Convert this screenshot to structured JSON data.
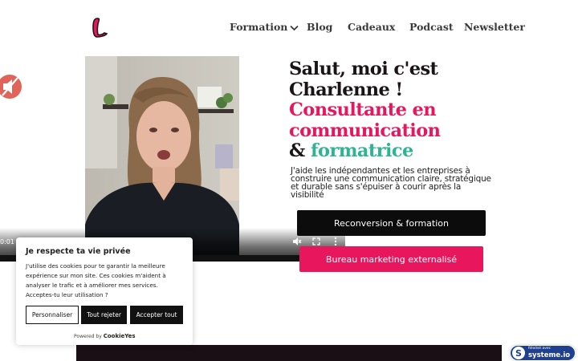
{
  "nav": {
    "items": [
      {
        "label": "Formation"
      },
      {
        "label": "Blog"
      },
      {
        "label": "Cadeaux"
      },
      {
        "label": "Podcast"
      },
      {
        "label": "Newsletter"
      }
    ]
  },
  "video": {
    "time": "0:01 /"
  },
  "hero": {
    "line1": "Salut, moi c'est",
    "line2": "Charlenne !",
    "line3": "Consultante en",
    "line4": "communication",
    "amp": "&",
    "line5": "formatrice",
    "description": "J'aide les indépendantes et les entreprises à construire une communication claire, stratégique et durable sans s'épuiser à courir après la visibilité"
  },
  "buttons": {
    "reconversion": "Reconversion & formation",
    "bureau": "Bureau marketing externalisé"
  },
  "cookie": {
    "title": "Je respecte ta vie privée",
    "text": "J'utilise des cookies pour te garantir la meilleure expérience sur mon site. Ces cookies m'aident à analyser le trafic et à améliorer mes services. Acceptes-tu leur utilisation ?",
    "customize": "Personnaliser",
    "reject": "Tout rejeter",
    "accept": "Accepter tout",
    "powered": "Powered by",
    "brand": "CookieYes"
  },
  "badge": {
    "small": "Réalisé avec",
    "name": "systeme.io"
  },
  "colors": {
    "pink": "#e8175d",
    "teal": "#2db493",
    "dark": "#1b1417",
    "badge_blue": "#1f3f8f"
  }
}
